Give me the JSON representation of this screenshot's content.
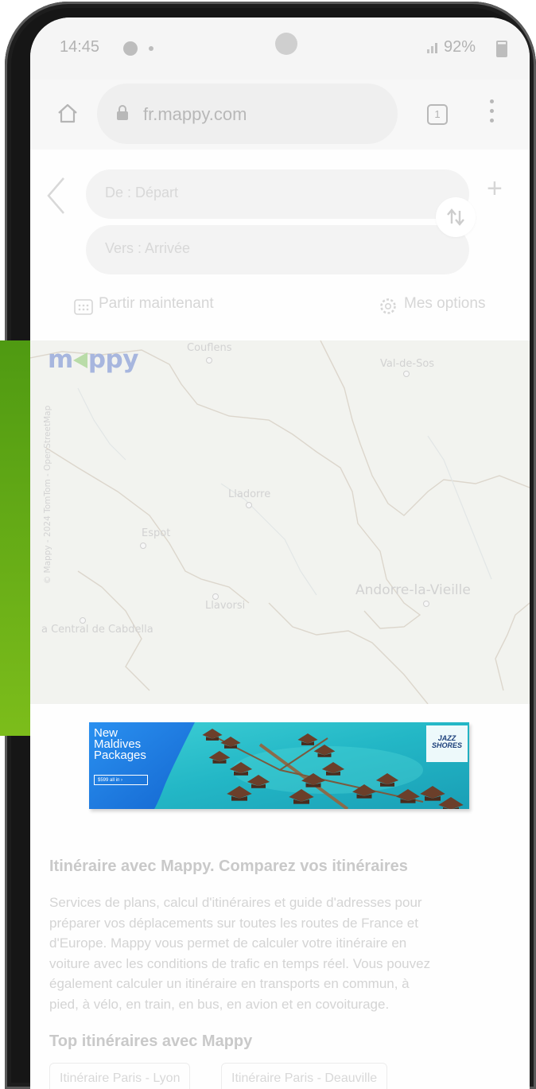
{
  "status_bar": {
    "time": "14:45",
    "battery": "92%"
  },
  "browser": {
    "url": "fr.mappy.com",
    "tab_count": "1"
  },
  "search": {
    "from_placeholder": "De : Départ",
    "to_placeholder": "Vers : Arrivée",
    "plus": "+",
    "depart_now": "Partir maintenant",
    "options": "Mes options"
  },
  "map": {
    "logo_left": "m",
    "logo_right": "ppy",
    "labels": [
      "Couflens",
      "Val-de-Sos",
      "Lladorre",
      "Espot",
      "Andorre-la-Vieille",
      "Llavorsi",
      "a Central de Cabdella"
    ],
    "copyright": "© Mappy - 2024 TomTom - OpenStreetMap"
  },
  "ad": {
    "headline_lines": [
      "New",
      "Maldives",
      "Packages"
    ],
    "cta": "$599 all in  ›",
    "brand_lines": [
      "JAZZ",
      "SHORES"
    ]
  },
  "content": {
    "title": "Itinéraire avec Mappy. Comparez vos itinéraires",
    "description_lines": [
      "Services de plans, calcul d'itinéraires et guide d'adresses pour",
      "préparer vos déplacements sur toutes les routes de France et",
      "d'Europe. Mappy vous permet de calculer votre itinéraire en",
      "voiture avec les conditions de trafic en temps réel. Vous pouvez",
      "également calculer un itinéraire en transports en commun, à",
      "pied, à vélo, en train, en bus, en avion et en covoiturage."
    ],
    "top_title": "Top itinéraires avec Mappy",
    "top_routes": [
      "Itinéraire Paris - Lyon",
      "Itinéraire Paris - Deauville"
    ]
  },
  "colors": {
    "side_bar_green": "#6cb517",
    "ad_blue": "#1c7fe3",
    "ad_water": "#23b7c6",
    "logo_blue": "#a7b6de"
  }
}
